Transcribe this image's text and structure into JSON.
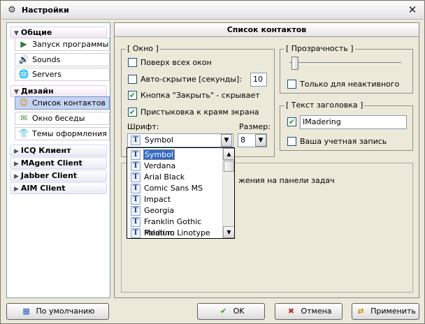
{
  "window": {
    "title": "Настройки"
  },
  "nav": {
    "general": {
      "label": "Общие",
      "items": [
        {
          "label": "Запуск программы",
          "icon": "run-program-icon"
        },
        {
          "label": "Sounds",
          "icon": "sounds-icon"
        },
        {
          "label": "Servers",
          "icon": "servers-icon"
        }
      ]
    },
    "design": {
      "label": "Дизайн",
      "items": [
        {
          "label": "Список контактов",
          "icon": "contact-list-icon",
          "selected": true
        },
        {
          "label": "Окно беседы",
          "icon": "chat-window-icon"
        },
        {
          "label": "Темы оформления",
          "icon": "themes-icon"
        }
      ]
    },
    "clients": [
      "ICQ Клиент",
      "MAgent Client",
      "Jabber Client",
      "AIM Client"
    ]
  },
  "main": {
    "header": "Список контактов",
    "window_group": {
      "title": "[ Окно ]",
      "always_on_top": {
        "label": "Поверх всех окон",
        "checked": false
      },
      "auto_hide": {
        "label": "Авто-скрытие [секунды]:",
        "checked": false,
        "value": "10"
      },
      "close_button_hides": {
        "label": "Кнопка \"Закрыть\" - скрывает",
        "checked": true
      },
      "dock_to_edges": {
        "label": "Пристыковка к краям экрана",
        "checked": true
      },
      "font_label": "Шрифт:",
      "font_value": "Symbol",
      "size_label": "Размер:",
      "size_value": "8"
    },
    "transparency_group": {
      "title": "[ Прозрачность ]",
      "level": 0,
      "inactive_only": {
        "label": "Только для неактивного",
        "checked": false
      }
    },
    "caption_group": {
      "title": "[ Текст заголовка ]",
      "caption_text": {
        "checked": true,
        "value": "IMadering"
      },
      "account": {
        "label": "Ваша учетная запись",
        "checked": false
      }
    },
    "hidden_text": "жения на панели задач",
    "font_list": [
      "Symbol",
      "Verdana",
      "Arial Black",
      "Comic Sans MS",
      "Impact",
      "Georgia",
      "Franklin Gothic Medium",
      "Palatino Linotype"
    ],
    "font_selected_index": 0
  },
  "buttons": {
    "default": "По умолчанию",
    "ok": "OK",
    "cancel": "Отмена",
    "apply": "Применить"
  },
  "colors": {
    "accent": "#316ac5",
    "check": "#21a121",
    "cancel_icon": "#c0282d"
  }
}
